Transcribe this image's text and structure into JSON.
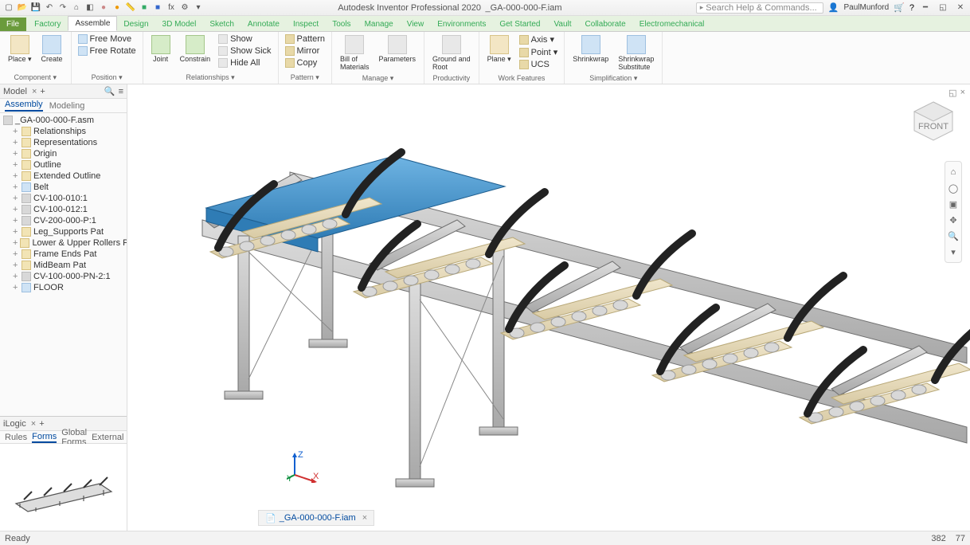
{
  "app": {
    "title_left": "Autodesk Inventor Professional 2020",
    "title_file": "_GA-000-000-F.iam",
    "search_placeholder": "Search Help & Commands...",
    "user": "PaulMunford"
  },
  "qat_icons": [
    "new",
    "open",
    "save",
    "undo",
    "redo",
    "home",
    "select",
    "material",
    "appearance",
    "measure",
    "color1",
    "color2",
    "fx",
    "tool",
    "style"
  ],
  "tabs": [
    "File",
    "Factory",
    "Assemble",
    "Design",
    "3D Model",
    "Sketch",
    "Annotate",
    "Inspect",
    "Tools",
    "Manage",
    "View",
    "Environments",
    "Get Started",
    "Vault",
    "Collaborate",
    "Electromechanical"
  ],
  "active_tab": "Assemble",
  "ribbon": {
    "panels": [
      {
        "name": "Component",
        "label": "Component ▾",
        "big": [
          {
            "t": "Place ▾",
            "c": ""
          },
          {
            "t": "Create",
            "c": "blue"
          }
        ],
        "small": []
      },
      {
        "name": "Position",
        "label": "Position ▾",
        "big": [],
        "small": [
          {
            "t": "Free Move",
            "c": "blue"
          },
          {
            "t": "Free Rotate",
            "c": "blue"
          }
        ]
      },
      {
        "name": "Relationships",
        "label": "Relationships ▾",
        "big": [
          {
            "t": "Joint",
            "c": "green"
          },
          {
            "t": "Constrain",
            "c": "green"
          }
        ],
        "small": [
          {
            "t": "Show",
            "c": "grey"
          },
          {
            "t": "Show Sick",
            "c": "grey"
          },
          {
            "t": "Hide All",
            "c": "grey"
          }
        ]
      },
      {
        "name": "Pattern",
        "label": "Pattern ▾",
        "big": [],
        "small": [
          {
            "t": "Pattern",
            "c": ""
          },
          {
            "t": "Mirror",
            "c": ""
          },
          {
            "t": "Copy",
            "c": ""
          }
        ]
      },
      {
        "name": "Manage",
        "label": "Manage ▾",
        "big": [
          {
            "t": "Bill of\nMaterials",
            "c": "grey"
          },
          {
            "t": "Parameters",
            "c": "grey"
          }
        ],
        "small": []
      },
      {
        "name": "Productivity",
        "label": "Productivity",
        "big": [
          {
            "t": "Ground and\nRoot",
            "c": "grey"
          }
        ],
        "small": []
      },
      {
        "name": "WorkFeatures",
        "label": "Work Features",
        "big": [
          {
            "t": "Plane ▾",
            "c": ""
          }
        ],
        "small": [
          {
            "t": "Axis ▾",
            "c": ""
          },
          {
            "t": "Point ▾",
            "c": ""
          },
          {
            "t": "UCS",
            "c": ""
          }
        ]
      },
      {
        "name": "Simplification",
        "label": "Simplification ▾",
        "big": [
          {
            "t": "Shrinkwrap",
            "c": "blue"
          },
          {
            "t": "Shrinkwrap\nSubstitute",
            "c": "blue"
          }
        ],
        "small": []
      }
    ]
  },
  "browser": {
    "title": "Model",
    "tabs": [
      "Assembly",
      "Modeling"
    ],
    "active": "Assembly",
    "nodes": [
      {
        "t": "_GA-000-000-F.asm",
        "i": "asm",
        "d": 0
      },
      {
        "t": "Relationships",
        "i": "f",
        "d": 1
      },
      {
        "t": "Representations",
        "i": "f",
        "d": 1
      },
      {
        "t": "Origin",
        "i": "f",
        "d": 1
      },
      {
        "t": "Outline",
        "i": "f",
        "d": 1
      },
      {
        "t": "Extended Outline",
        "i": "f",
        "d": 1
      },
      {
        "t": "Belt",
        "i": "part",
        "d": 1
      },
      {
        "t": "CV-100-010:1",
        "i": "asm",
        "d": 1
      },
      {
        "t": "CV-100-012:1",
        "i": "asm",
        "d": 1
      },
      {
        "t": "CV-200-000-P:1",
        "i": "asm",
        "d": 1
      },
      {
        "t": "Leg_Supports Pat",
        "i": "f",
        "d": 1
      },
      {
        "t": "Lower & Upper Rollers Pat",
        "i": "f",
        "d": 1
      },
      {
        "t": "Frame Ends Pat",
        "i": "f",
        "d": 1
      },
      {
        "t": "MidBeam Pat",
        "i": "f",
        "d": 1
      },
      {
        "t": "CV-100-000-PN-2:1",
        "i": "asm",
        "d": 1
      },
      {
        "t": "FLOOR",
        "i": "part",
        "d": 1
      }
    ]
  },
  "ilogic": {
    "title": "iLogic",
    "tabs": [
      "Rules",
      "Forms",
      "Global Forms",
      "External"
    ],
    "active": "Forms"
  },
  "doc_tab": "_GA-000-000-F.iam",
  "triad": {
    "x": "X",
    "y": "Y",
    "z": "Z"
  },
  "viewcube_face": "FRONT",
  "nav_tools": [
    "home",
    "orbit",
    "lookat",
    "pan",
    "zoom",
    "toggle"
  ],
  "status": {
    "left": "Ready",
    "r1": "382",
    "r2": "77"
  }
}
